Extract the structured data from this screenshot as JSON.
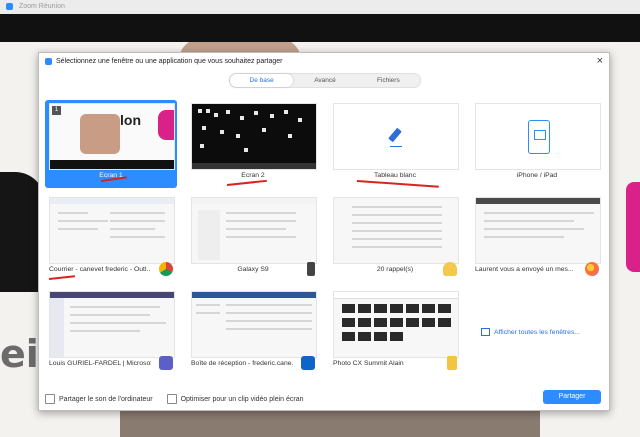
{
  "app": {
    "window_title": "Zoom Réunion"
  },
  "dialog": {
    "title": "Sélectionnez une fenêtre ou une application que vous souhaitez partager",
    "close_symbol": "×",
    "tabs": [
      {
        "label": "De base",
        "active": true
      },
      {
        "label": "Avancé",
        "active": false
      },
      {
        "label": "Fichiers",
        "active": false
      }
    ],
    "tiles": [
      {
        "label": "Écran 1",
        "kind": "screen",
        "selected": true,
        "number": "1"
      },
      {
        "label": "Écran 2",
        "kind": "desktop",
        "selected": false
      },
      {
        "label": "Tableau blanc",
        "kind": "whiteboard",
        "selected": false
      },
      {
        "label": "iPhone / iPad",
        "kind": "ipad",
        "selected": false
      },
      {
        "label": "Courrier - canevet frederic - Outl...",
        "kind": "window",
        "app_icon": "chrome-icon"
      },
      {
        "label": "Galaxy S9",
        "kind": "window",
        "app_icon": "phone-icon"
      },
      {
        "label": "20 rappel(s)",
        "kind": "window",
        "app_icon": "bell-icon"
      },
      {
        "label": "Laurent vous a envoyé un mes...",
        "kind": "window",
        "app_icon": "firefox-icon"
      },
      {
        "label": "Louis GURIEL-FARDEL | Microsoft...",
        "kind": "window",
        "app_icon": "teams-icon"
      },
      {
        "label": "Boîte de réception - frederic.cane...",
        "kind": "window",
        "app_icon": "outlook-icon"
      },
      {
        "label": "Photo CX Summit Alain",
        "kind": "photos",
        "app_icon": "folder-icon"
      }
    ],
    "show_all_windows": "Afficher toutes les fenêtres...",
    "footer": {
      "share_sound": "Partager le son de l'ordinateur",
      "optimize_video": "Optimiser pour un clip vidéo plein écran",
      "share_button": "Partager"
    }
  },
  "colors": {
    "accent": "#2d8cff",
    "annotation_red": "#d8231f"
  }
}
